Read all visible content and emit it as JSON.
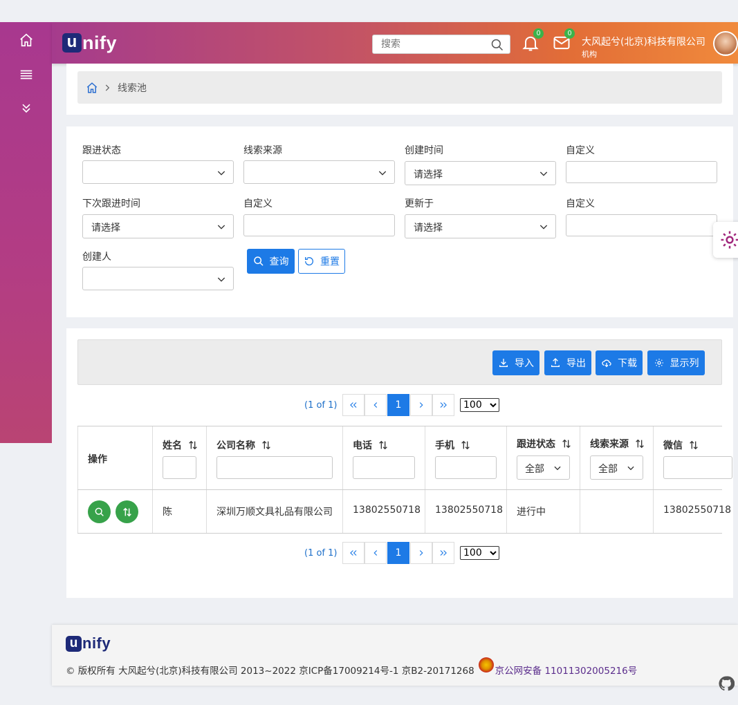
{
  "header": {
    "logo_u": "u",
    "logo_rest": "nify",
    "search_placeholder": "搜索",
    "notifications_count": "0",
    "messages_count": "0",
    "org_name": "大风起兮(北京)科技有限公司",
    "org_type": "机构"
  },
  "breadcrumb": {
    "current": "线索池"
  },
  "filters": {
    "follow_status_label": "跟进状态",
    "lead_source_label": "线索来源",
    "created_time_label": "创建时间",
    "created_time_value": "请选择",
    "custom1_label": "自定义",
    "next_follow_label": "下次跟进时间",
    "next_follow_value": "请选择",
    "custom2_label": "自定义",
    "updated_label": "更新于",
    "updated_value": "请选择",
    "custom3_label": "自定义",
    "creator_label": "创建人",
    "query_button": "查询",
    "reset_button": "重置"
  },
  "toolbar": {
    "import": "导入",
    "export": "导出",
    "download": "下载",
    "columns": "显示列"
  },
  "pager": {
    "info": "(1 of 1)",
    "current_page": "1",
    "page_size": "100",
    "page_size_options": [
      "100"
    ]
  },
  "table": {
    "headers": {
      "actions": "操作",
      "name": "姓名",
      "company": "公司名称",
      "phone": "电话",
      "mobile": "手机",
      "follow_status": "跟进状态",
      "lead_source": "线索来源",
      "wechat": "微信"
    },
    "filter_all": "全部",
    "rows": [
      {
        "name": "陈",
        "company": "深圳万顺文具礼品有限公司",
        "phone": "13802550718",
        "mobile": "13802550718",
        "follow_status": "进行中",
        "lead_source": "",
        "wechat": "13802550718"
      }
    ]
  },
  "footer": {
    "logo_u": "u",
    "logo_rest": "nify",
    "copyright": "© 版权所有 大风起兮(北京)科技有限公司 2013~2022 京ICP备17009214号-1 京B2-20171268",
    "gongan": "京公网安备 11011302005216号"
  },
  "colors": {
    "primary": "#1d7ae6",
    "sidebar": "#a8388f",
    "header_start": "#a53b8d",
    "header_end": "#f08a3c",
    "success": "#37a24a"
  },
  "icons": [
    "home-icon",
    "menu-icon",
    "chevrons-down-icon",
    "search-icon",
    "bell-icon",
    "mail-icon",
    "chevron-right-icon",
    "chevron-down-icon",
    "refresh-icon",
    "download-icon",
    "upload-icon",
    "cloud-download-icon",
    "gear-icon",
    "sort-icon",
    "github-icon"
  ]
}
